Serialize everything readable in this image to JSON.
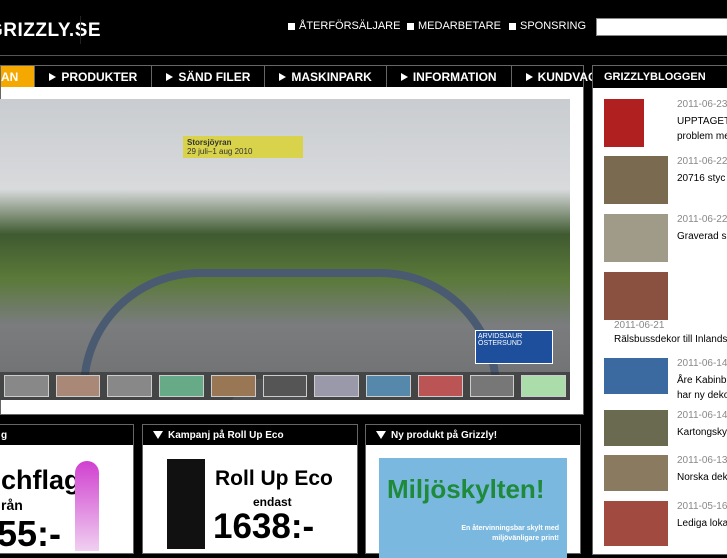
{
  "header": {
    "logo": "GRIZZLY.SE",
    "links": [
      "ÅTERFÖRSÄLJARE",
      "MEDARBETARE",
      "SPONSRING"
    ],
    "search_value": ""
  },
  "nav": {
    "active": "AN",
    "tabs": [
      "PRODUKTER",
      "SÄND FILER",
      "MASKINPARK",
      "INFORMATION",
      "KUNDVAGN"
    ]
  },
  "hero": {
    "sign": "Storsjöyran",
    "sign_sub": "29 juli–1 aug 2010",
    "road_sign": "ARVIDSJAUR ÖSTERSUND"
  },
  "blog": {
    "title": "GRIZZLYBLOGGEN",
    "items": [
      {
        "date": "2011-06-23",
        "title": "UPPTAGET",
        "title2": "problem me",
        "color": "#b02020"
      },
      {
        "date": "2011-06-22",
        "title": "20716 styc",
        "color": "#7a6a50"
      },
      {
        "date": "2011-06-22",
        "title": "Graverad s",
        "color": "#a09a88"
      },
      {
        "date": "2011-06-21",
        "title": "Rälsbussdekor till Inlands",
        "color": "#8a5040"
      },
      {
        "date": "2011-06-14",
        "title": "Åre Kabinbe",
        "title2": "har ny deko",
        "color": "#3a6aa0"
      },
      {
        "date": "2011-06-14",
        "title": "Kartongsky",
        "color": "#6a6a50"
      },
      {
        "date": "2011-06-13",
        "title": "Norska dek",
        "color": "#8a7a60"
      },
      {
        "date": "2011-05-16",
        "title": "Lediga loka",
        "color": "#a04a40"
      }
    ]
  },
  "boxes": [
    {
      "title": "g",
      "headline": "chflag",
      "sub": "rån",
      "price": "55:-"
    },
    {
      "title": "Kampanj på Roll Up Eco",
      "headline": "Roll Up Eco",
      "sub": "endast",
      "price": "1638:-"
    },
    {
      "title": "Ny produkt på Grizzly!",
      "headline": "Miljöskylten!",
      "sub": "En återvinningsbar skylt med miljövänligare print!"
    }
  ]
}
